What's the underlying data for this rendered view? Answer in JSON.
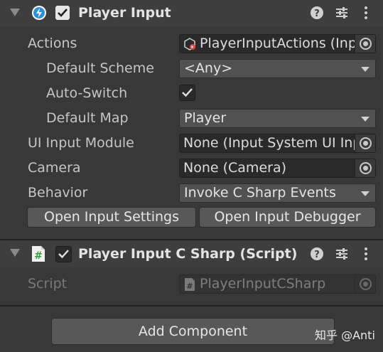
{
  "player_input": {
    "title": "Player Input",
    "enabled": true,
    "fields": {
      "actions_label": "Actions",
      "actions_value": "PlayerInputActions (Inp",
      "default_scheme_label": "Default Scheme",
      "default_scheme_value": "<Any>",
      "auto_switch_label": "Auto-Switch",
      "auto_switch_checked": true,
      "default_map_label": "Default Map",
      "default_map_value": "Player",
      "ui_input_module_label": "UI Input Module",
      "ui_input_module_value": "None (Input System UI Inp",
      "camera_label": "Camera",
      "camera_value": "None (Camera)",
      "behavior_label": "Behavior",
      "behavior_value": "Invoke C Sharp Events"
    },
    "buttons": {
      "open_settings": "Open Input Settings",
      "open_debugger": "Open Input Debugger"
    }
  },
  "script_component": {
    "title": "Player Input C Sharp (Script)",
    "enabled": true,
    "script_label": "Script",
    "script_value": "PlayerInputCSharp"
  },
  "add_component_label": "Add Component",
  "header_icons": [
    "help-icon",
    "preset-icon",
    "more-icon"
  ],
  "watermark": "知乎 @Anti",
  "colors": {
    "background": "#383838",
    "header": "#3e3e3e",
    "field": "#2a2a2a",
    "dropdown": "#515151",
    "button": "#585858",
    "input_system_icon": "#2f8fd8",
    "script_icon": "#4caf50"
  }
}
